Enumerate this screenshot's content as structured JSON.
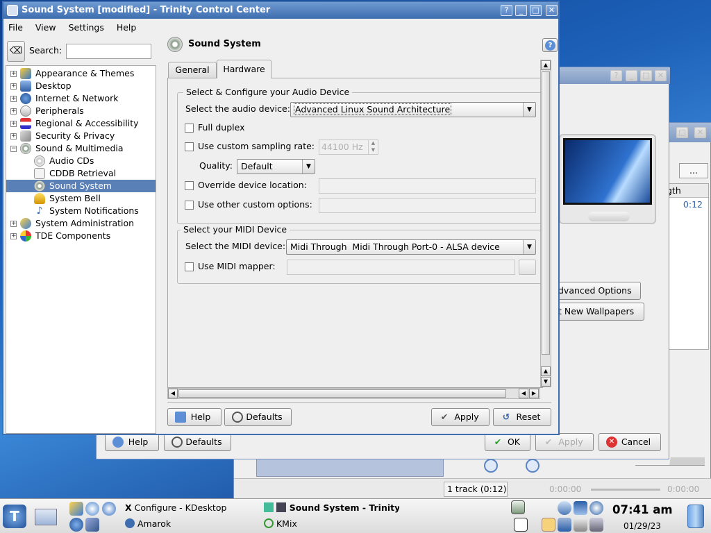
{
  "main_window": {
    "title": "Sound System [modified] - Trinity Control Center",
    "menu": [
      "File",
      "View",
      "Settings",
      "Help"
    ],
    "search_label": "Search:",
    "search_value": "",
    "tree": [
      {
        "label": "Appearance & Themes",
        "expander": "+"
      },
      {
        "label": "Desktop",
        "expander": "+"
      },
      {
        "label": "Internet & Network",
        "expander": "+"
      },
      {
        "label": "Peripherals",
        "expander": "+"
      },
      {
        "label": "Regional & Accessibility",
        "expander": "+"
      },
      {
        "label": "Security & Privacy",
        "expander": "+"
      },
      {
        "label": "Sound & Multimedia",
        "expander": "−"
      },
      {
        "label": "Audio CDs"
      },
      {
        "label": "CDDB Retrieval"
      },
      {
        "label": "Sound System",
        "selected": true
      },
      {
        "label": "System Bell"
      },
      {
        "label": "System Notifications"
      },
      {
        "label": "System Administration",
        "expander": "+"
      },
      {
        "label": "TDE Components",
        "expander": "+"
      }
    ],
    "module_title": "Sound System",
    "tabs": [
      {
        "label": "General"
      },
      {
        "label": "Hardware",
        "active": true
      }
    ],
    "audio_group": {
      "title": "Select & Configure your Audio Device",
      "device_label": "Select the audio device:",
      "device_value": "Advanced Linux Sound Architecture",
      "full_duplex": "Full duplex",
      "custom_rate": "Use custom sampling rate:",
      "rate_value": "44100 Hz",
      "quality_label": "Quality:",
      "quality_value": "Default",
      "override_location": "Override device location:",
      "custom_options": "Use other custom options:"
    },
    "midi_group": {
      "title": "Select your MIDI Device",
      "device_label": "Select the MIDI device:",
      "device_value": "Midi Through  Midi Through Port-0 - ALSA device",
      "mapper": "Use MIDI mapper:"
    },
    "buttons": {
      "help": "Help",
      "defaults": "Defaults",
      "apply": "Apply",
      "reset": "Reset"
    }
  },
  "bg_window": {
    "buttons": {
      "help": "Help",
      "defaults": "Defaults",
      "ok": "OK",
      "apply": "Apply",
      "cancel": "Cancel"
    },
    "advanced": "dvanced Options",
    "wallpapers": "t New Wallpapers",
    "browse": "..."
  },
  "amarok_window": {
    "column_header": "gth",
    "length": "0:12",
    "track_count": "1 track (0:12)",
    "time_left": "0:00:00",
    "time_right": "0:00:00"
  },
  "taskbar": {
    "tasks": [
      {
        "label": "Configure - KDesktop"
      },
      {
        "label": "Sound System - Trinity",
        "active": true
      },
      {
        "label": "Amarok"
      },
      {
        "label": "KMix"
      }
    ],
    "clock_time": "07:41 am",
    "clock_date": "01/29/23",
    "colors": {
      "accent": "#3e6db0",
      "selection": "#5a80b8"
    }
  }
}
